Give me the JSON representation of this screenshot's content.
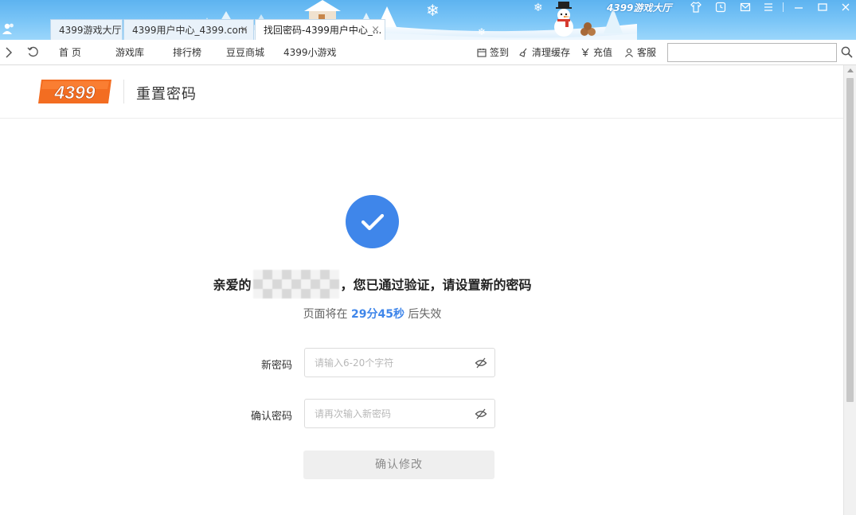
{
  "titlebar": {
    "brand": "4399游戏大厅",
    "tabs": [
      {
        "label": "4399游戏大厅",
        "state": "inactive"
      },
      {
        "label": "4399用户中心_4399.com",
        "state": "inactive",
        "close": "×"
      },
      {
        "label": "找回密码-4399用户中心_...",
        "state": "active",
        "close": "×"
      }
    ],
    "window_icons": [
      "shirt-icon",
      "clock-icon",
      "mail-icon",
      "menu-icon",
      "minimize-icon",
      "maximize-icon",
      "close-icon"
    ]
  },
  "navbar": {
    "links": [
      "首 页",
      "游戏库",
      "排行榜",
      "豆豆商城",
      "4399小游戏"
    ],
    "sign_in": "签到",
    "clear_cache": "清理缓存",
    "recharge": "充值",
    "service": "客服",
    "address_value": ""
  },
  "page": {
    "logo_text": "4399",
    "title": "重置密码",
    "greeting_prefix": "亲爱的",
    "greeting_suffix": "，您已通过验证，请设置新的密码",
    "countdown_prefix": "页面将在 ",
    "countdown_value": "29分45秒",
    "countdown_suffix": " 后失效",
    "new_password_label": "新密码",
    "new_password_placeholder": "请输入6-20个字符",
    "confirm_password_label": "确认密码",
    "confirm_password_placeholder": "请再次输入新密码",
    "submit_label": "确认修改"
  },
  "colors": {
    "accent": "#3f86ea",
    "logo_orange": "#f36d21",
    "titlebar": "#6bbcf3"
  }
}
